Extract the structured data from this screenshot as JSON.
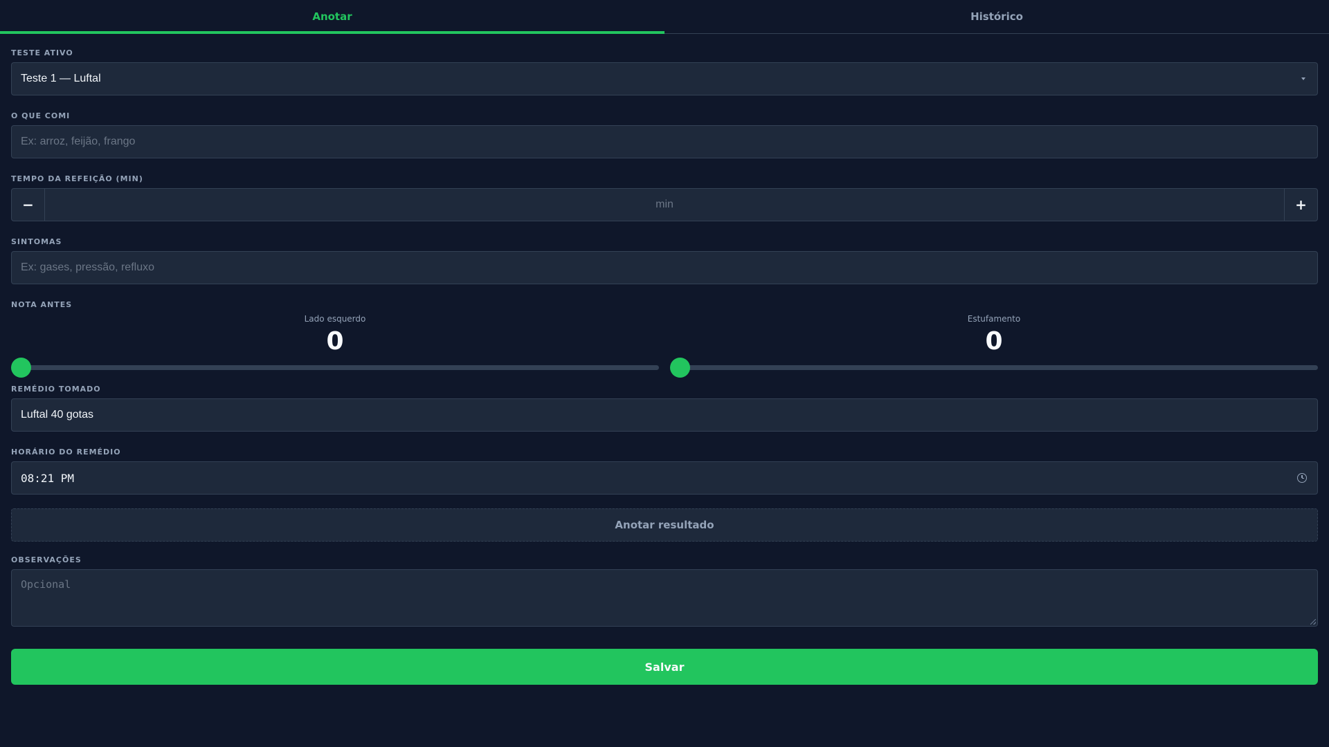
{
  "tabs": [
    {
      "label": "Anotar",
      "active": true
    },
    {
      "label": "Histórico",
      "active": false
    }
  ],
  "form": {
    "active_test": {
      "label": "TESTE ATIVO",
      "value": "Teste 1 — Luftal"
    },
    "food": {
      "label": "O QUE COMI",
      "placeholder": "Ex: arroz, feijão, frango"
    },
    "meal_time": {
      "label": "TEMPO DA REFEIÇÃO (MIN)",
      "placeholder": "min",
      "minus": "−",
      "plus": "+"
    },
    "symptoms": {
      "label": "SINTOMAS",
      "placeholder": "Ex: gases, pressão, refluxo"
    },
    "score_before": {
      "label": "NOTA ANTES",
      "left_side": {
        "name": "Lado esquerdo",
        "value": "0",
        "fraction": 0
      },
      "bloating": {
        "name": "Estufamento",
        "value": "0",
        "fraction": 0
      }
    },
    "remedy": {
      "label": "REMÉDIO TOMADO",
      "value": "Luftal 40 gotas"
    },
    "remedy_time": {
      "label": "HORÁRIO DO REMÉDIO",
      "value": "08:21 PM"
    },
    "result_button": "Anotar resultado",
    "notes": {
      "label": "OBSERVAÇÕES",
      "placeholder": "Opcional"
    },
    "save_button": "Salvar"
  },
  "colors": {
    "background": "#0f172a",
    "accent": "#22c55e",
    "field": "#1e293b",
    "border": "#334155"
  }
}
